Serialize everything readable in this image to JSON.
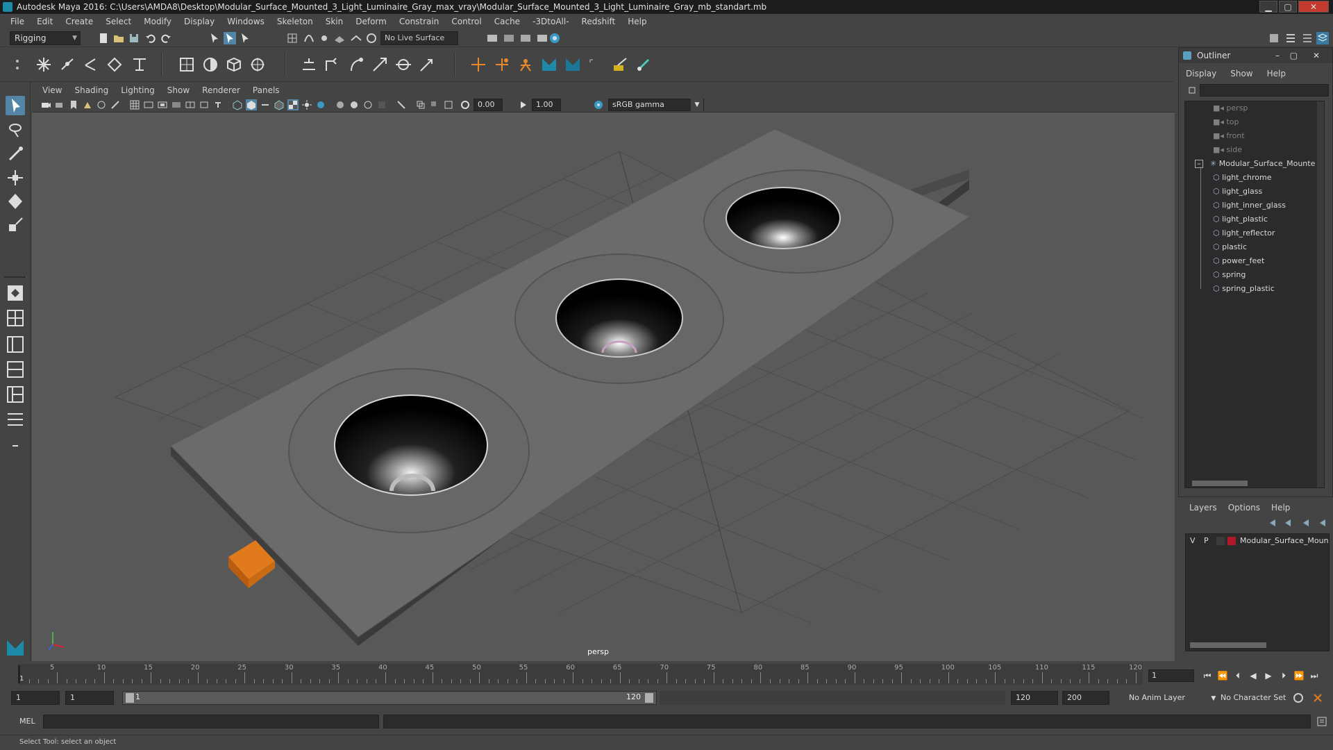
{
  "window": {
    "title": "Autodesk Maya 2016: C:\\Users\\AMDA8\\Desktop\\Modular_Surface_Mounted_3_Light_Luminaire_Gray_max_vray\\Modular_Surface_Mounted_3_Light_Luminaire_Gray_mb_standart.mb",
    "controls": {
      "minimize": "▁",
      "maximize": "▢",
      "close": "✕"
    }
  },
  "menubar": [
    "File",
    "Edit",
    "Create",
    "Select",
    "Modify",
    "Display",
    "Windows",
    "Skeleton",
    "Skin",
    "Deform",
    "Constrain",
    "Control",
    "Cache",
    "-3DtoAll-",
    "Redshift",
    "Help"
  ],
  "statusline": {
    "mode": "Rigging",
    "live_surface": "No Live Surface"
  },
  "panel": {
    "menus": [
      "View",
      "Shading",
      "Lighting",
      "Show",
      "Renderer",
      "Panels"
    ],
    "exposure": "0.00",
    "gamma": "1.00",
    "color_space": "sRGB gamma"
  },
  "viewport": {
    "camera_label": "persp"
  },
  "outliner": {
    "title": "Outliner",
    "menus": [
      "Display",
      "Show",
      "Help"
    ],
    "cameras": [
      "persp",
      "top",
      "front",
      "side"
    ],
    "group": "Modular_Surface_Mounte",
    "meshes": [
      "light_chrome",
      "light_glass",
      "light_inner_glass",
      "light_plastic",
      "light_reflector",
      "plastic",
      "power_feet",
      "spring",
      "spring_plastic"
    ]
  },
  "layers": {
    "menus": [
      "Layers",
      "Options",
      "Help"
    ],
    "row": {
      "v": "V",
      "p": "P",
      "name": "Modular_Surface_Moun",
      "color": "#b0182a"
    }
  },
  "timeline": {
    "ticks": [
      "5",
      "10",
      "15",
      "20",
      "25",
      "30",
      "35",
      "40",
      "45",
      "50",
      "55",
      "60",
      "65",
      "70",
      "75",
      "80",
      "85",
      "90",
      "95",
      "100",
      "105",
      "110",
      "115",
      "120"
    ],
    "first_tick": "1",
    "current_frame": "1"
  },
  "range": {
    "start": "1",
    "anim_start": "1",
    "slider_low": "1",
    "slider_high": "120",
    "anim_end": "120",
    "end": "200",
    "anim_layer": "No Anim Layer",
    "character_set": "No Character Set"
  },
  "command": {
    "label": "MEL"
  },
  "help": {
    "text": "Select Tool: select an object"
  }
}
